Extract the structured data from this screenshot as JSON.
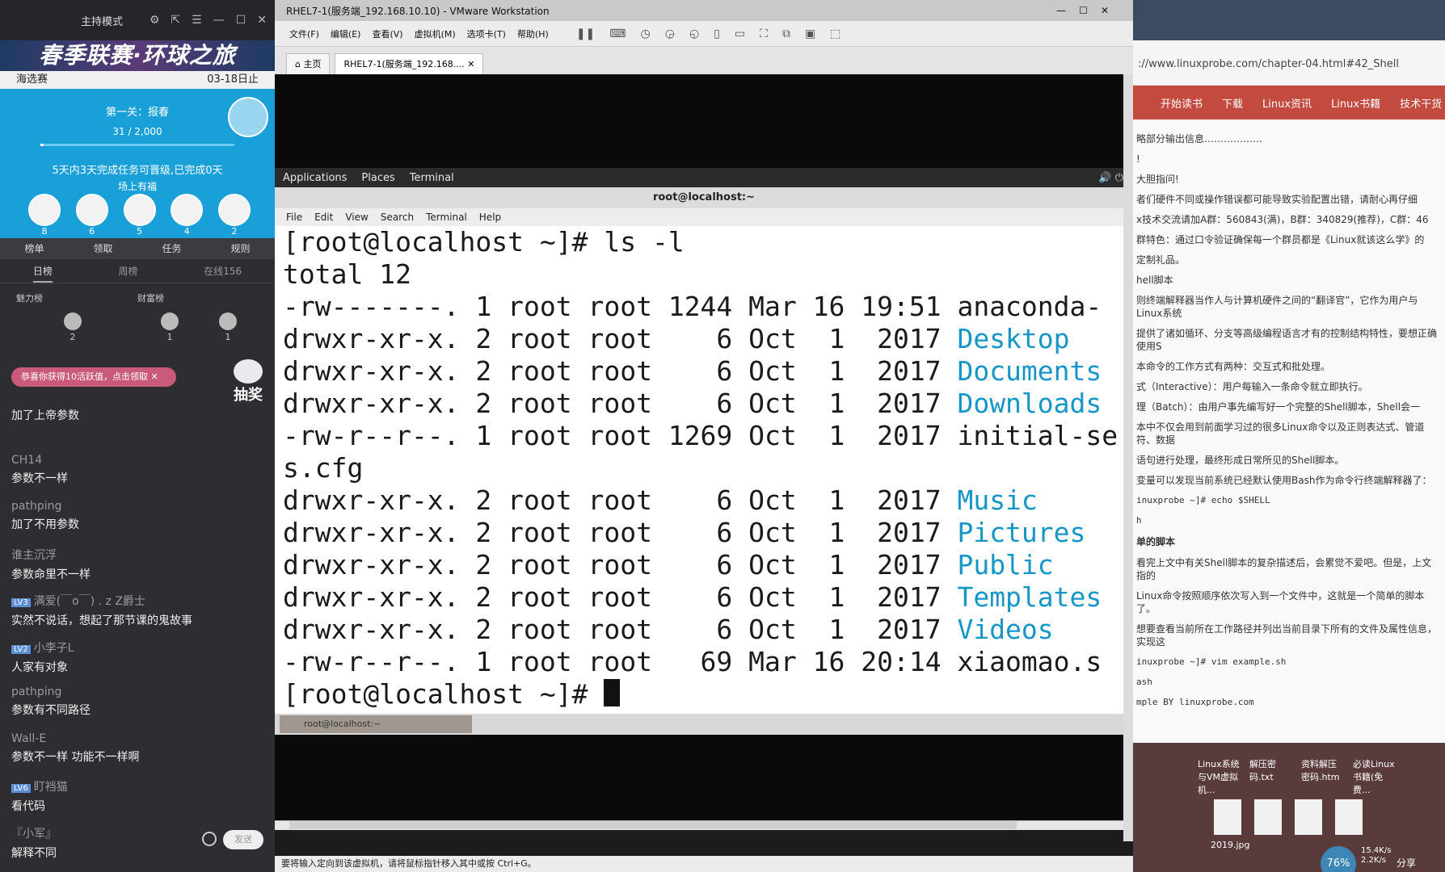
{
  "left_panel": {
    "mode_label": "主持模式",
    "banner": "春季联赛·环球之旅",
    "date_bar": {
      "left": "海选赛",
      "right": "03-18日止"
    },
    "task": {
      "level": "第一关：报春",
      "progress_text": "31 / 2,000",
      "progress_fraction": 0.0155,
      "note": "5天内3天完成任务可晋级,已完成0天",
      "subtitle": "场上有福",
      "avatar_counts": [
        "8",
        "6",
        "5",
        "4",
        "2"
      ]
    },
    "tabs": [
      "榜单",
      "领取",
      "任务",
      "规则"
    ],
    "sub_tabs": [
      "日榜",
      "周榜",
      "在线156"
    ],
    "ranks": {
      "charm_label": "魅力榜",
      "wealth_label": "财富榜",
      "values": [
        "2",
        "1",
        "1"
      ]
    },
    "toast": "恭喜你获得10活跃值，点击领取",
    "lottery": "抽奖",
    "chat": [
      {
        "user": "",
        "text": "加了上帝参数",
        "level": ""
      },
      {
        "user": "CH14",
        "text": "参数不一样",
        "level": ""
      },
      {
        "user": "pathping",
        "text": "加了不用参数",
        "level": ""
      },
      {
        "user": "谁主沉浮",
        "text": "参数命里不一样",
        "level": ""
      },
      {
        "user": "满爱(￣o￣) . z Z爵士",
        "text": "实然不说话，想起了那节课的鬼故事",
        "level": "LV3"
      },
      {
        "user": "小李子L",
        "text": "人家有对象",
        "level": "LV2"
      },
      {
        "user": "pathping",
        "text": "参数有不同路径",
        "level": ""
      },
      {
        "user": "Wall-E",
        "text": "参数不一样 功能不一样啊",
        "level": ""
      },
      {
        "user": "盯裆猫",
        "text": "看代码",
        "level": "LV6"
      },
      {
        "user": "『小军』",
        "text": "解释不同",
        "level": ""
      }
    ],
    "send_label": "发送"
  },
  "vmware": {
    "title": "RHEL7-1(服务端_192.168.10.10) - VMware Workstation",
    "menus": [
      "文件(F)",
      "编辑(E)",
      "查看(V)",
      "虚拟机(M)",
      "选项卡(T)",
      "帮助(H)"
    ],
    "tabs": [
      "主页",
      "RHEL7-1(服务端_192.168...."
    ],
    "gnome_bar": [
      "Applications",
      "Places",
      "Terminal"
    ],
    "terminal_title": "root@localhost:~",
    "terminal_menus": [
      "File",
      "Edit",
      "View",
      "Search",
      "Terminal",
      "Help"
    ],
    "terminal_lines": [
      {
        "text": "[root@localhost ~]# ls -l",
        "name": ""
      },
      {
        "text": "total 12",
        "name": ""
      },
      {
        "text": "-rw-------. 1 root root 1244 Mar 16 19:51 ",
        "name": "anaconda-",
        "blue": false
      },
      {
        "text": "drwxr-xr-x. 2 root root    6 Oct  1  2017 ",
        "name": "Desktop",
        "blue": true
      },
      {
        "text": "drwxr-xr-x. 2 root root    6 Oct  1  2017 ",
        "name": "Documents",
        "blue": true
      },
      {
        "text": "drwxr-xr-x. 2 root root    6 Oct  1  2017 ",
        "name": "Downloads",
        "blue": true
      },
      {
        "text": "-rw-r--r--. 1 root root 1269 Oct  1  2017 ",
        "name": "initial-se",
        "blue": false
      },
      {
        "text": "s.cfg",
        "name": ""
      },
      {
        "text": "drwxr-xr-x. 2 root root    6 Oct  1  2017 ",
        "name": "Music",
        "blue": true
      },
      {
        "text": "drwxr-xr-x. 2 root root    6 Oct  1  2017 ",
        "name": "Pictures",
        "blue": true
      },
      {
        "text": "drwxr-xr-x. 2 root root    6 Oct  1  2017 ",
        "name": "Public",
        "blue": true
      },
      {
        "text": "drwxr-xr-x. 2 root root    6 Oct  1  2017 ",
        "name": "Templates",
        "blue": true
      },
      {
        "text": "drwxr-xr-x. 2 root root    6 Oct  1  2017 ",
        "name": "Videos",
        "blue": true
      },
      {
        "text": "-rw-r--r--. 1 root root   69 Mar 16 20:14 ",
        "name": "xiaomao.s",
        "blue": false
      },
      {
        "text": "[root@localhost ~]# ",
        "name": ""
      }
    ],
    "taskbar_item": "root@localhost:~",
    "status": "要将输入定向到该虚拟机，请将鼠标指针移入其中或按 Ctrl+G。",
    "link_color": "#1596c8"
  },
  "browser": {
    "url": "://www.linuxprobe.com/chapter-04.html#42_Shell",
    "nav": [
      "开始读书",
      "下载",
      "Linux资讯",
      "Linux书籍",
      "技术干货"
    ],
    "article": [
      "略部分输出信息………………",
      "!",
      "大胆指问!",
      "者们硬件不同或操作错误都可能导致实验配置出错，请耐心再仔细",
      "x技术交流请加A群：560843(满)，B群：340829(推荐)，C群：46",
      "群特色：通过口令验证确保每一个群员都是《Linux就该这么学》的",
      "定制礼品。",
      "hell脚本",
      "则终端解释器当作人与计算机硬件之间的“翻译官”，它作为用户与Linux系统",
      "提供了诸如循环、分支等高级编程语言才有的控制结构特性，要想正确使用S",
      "本命令的工作方式有两种：交互式和批处理。",
      "式（Interactive）：用户每输入一条命令就立即执行。",
      "理（Batch）：由用户事先编写好一个完整的Shell脚本，Shell会一",
      "本中不仅会用到前面学习过的很多Linux命令以及正则表达式、管道符、数据",
      "语句进行处理，最终形成日常所见的Shell脚本。",
      "变量可以发现当前系统已经默认使用Bash作为命令行终端解释器了："
    ],
    "code1": [
      "inuxprobe ~]# echo $SHELL",
      "h"
    ],
    "heading2": "单的脚本",
    "article2": [
      "看完上文中有关Shell脚本的复杂描述后，会累觉不爱吧。但是，上文指的",
      "Linux命令按照顺序依次写入到一个文件中，这就是一个简单的脚本了。",
      "想要查看当前所在工作路径并列出当前目录下所有的文件及属性信息，实现这"
    ],
    "code2": [
      "inuxprobe ~]# vim example.sh",
      "ash",
      "mple BY linuxprobe.com"
    ],
    "nav_color": "#c24a3e"
  },
  "desktop": {
    "icons": [
      "Linux系统与VM虚拟机...",
      "解压密码.txt",
      "资料解压密码.htm",
      "必读Linux书籍(免费..."
    ],
    "file_label": "2019.jpg",
    "cpu": "76%",
    "net_up": "15.4K/s",
    "net_down": "2.2K/s",
    "share": "分享"
  }
}
